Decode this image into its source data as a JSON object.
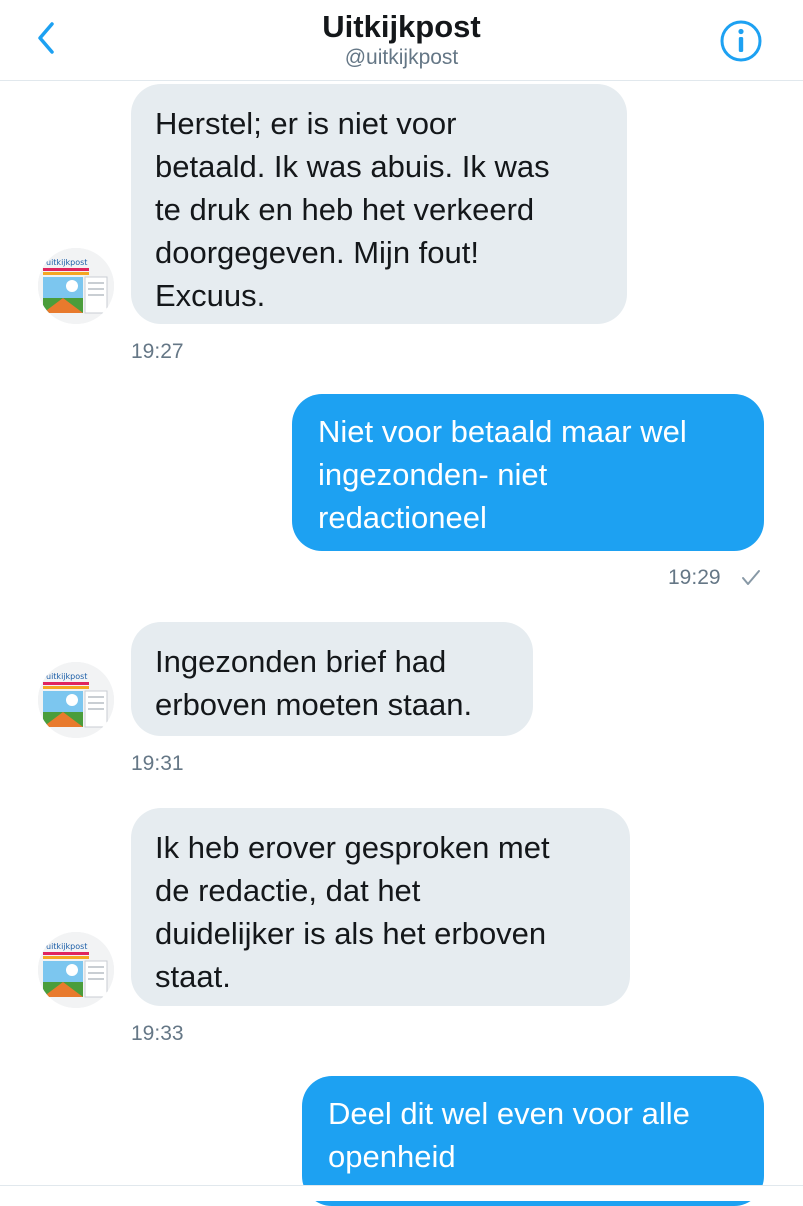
{
  "header": {
    "title": "Uitkijkpost",
    "handle": "@uitkijkpost"
  },
  "colors": {
    "accent": "#1da1f2",
    "incoming_bubble": "#e6ecf0",
    "meta_text": "#657786"
  },
  "icons": {
    "back": "chevron-left-icon",
    "info": "info-circle-icon",
    "read": "check-icon"
  },
  "messages": [
    {
      "side": "incoming",
      "text": "Herstel; er is niet voor\nbetaald. Ik was abuis. Ik was\nte druk en heb het verkeerd\ndoorgegeven. Mijn fout!\nExcuus.",
      "time": "19:27"
    },
    {
      "side": "outgoing",
      "text": "Niet voor betaald maar wel\ningezonden- niet\nredactioneel",
      "time": "19:29"
    },
    {
      "side": "incoming",
      "text": "Ingezonden brief had\nerboven moeten staan.",
      "time": "19:31"
    },
    {
      "side": "incoming",
      "text": "Ik heb erover gesproken met\nde redactie, dat het\nduidelijker is als het erboven\nstaat.",
      "time": "19:33"
    },
    {
      "side": "outgoing",
      "text": "Deel dit wel even voor alle\nopenheid",
      "time": ""
    }
  ]
}
